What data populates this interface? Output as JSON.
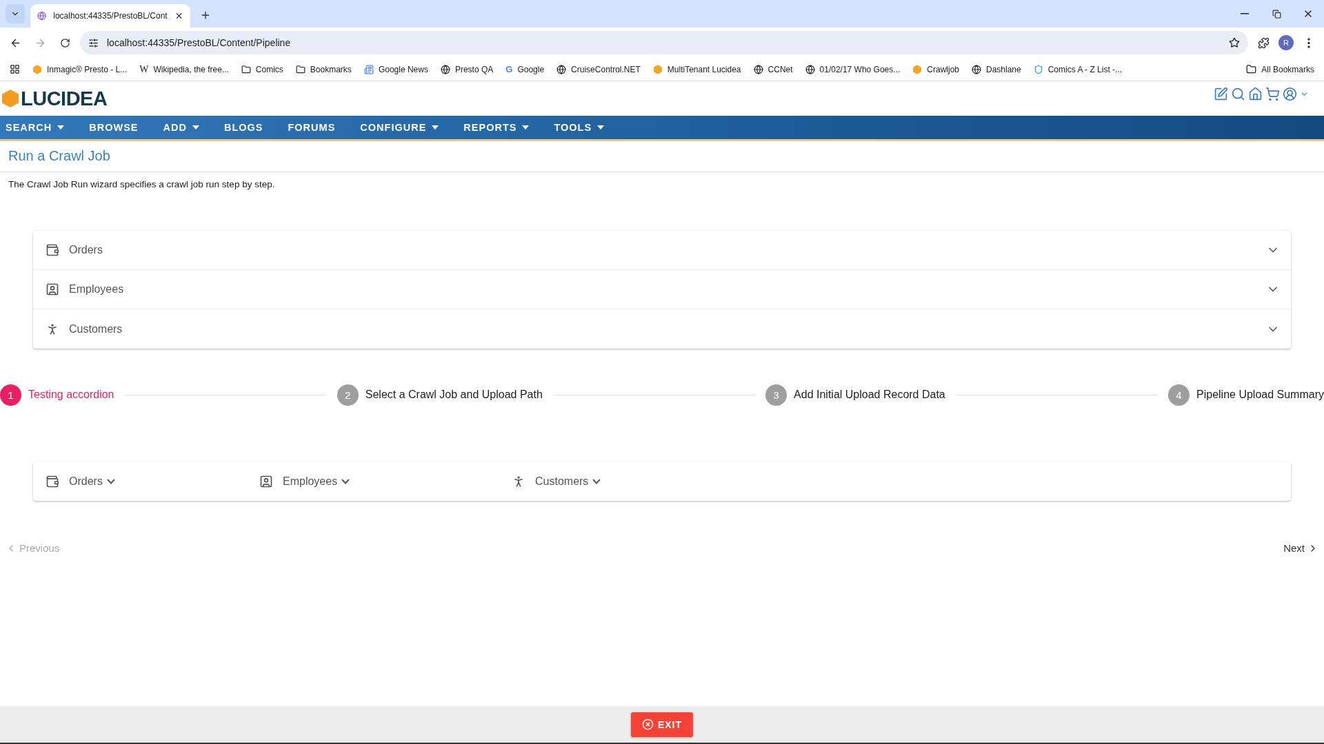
{
  "browser": {
    "tab_title": "localhost:44335/PrestoBL/Cont",
    "url": "localhost:44335/PrestoBL/Content/Pipeline",
    "profile": "R",
    "bookmarks": [
      {
        "kind": "cube",
        "label": "Inmagic® Presto - L..."
      },
      {
        "kind": "wiki",
        "glyph": "W",
        "label": "Wikipedia, the free..."
      },
      {
        "kind": "folder",
        "label": "Comics"
      },
      {
        "kind": "folder",
        "label": "Bookmarks"
      },
      {
        "kind": "news",
        "label": "Google News"
      },
      {
        "kind": "globe",
        "label": "Presto QA"
      },
      {
        "kind": "google",
        "glyph": "G",
        "label": "Google"
      },
      {
        "kind": "globe",
        "label": "CruiseControl.NET"
      },
      {
        "kind": "cube",
        "label": "MultiTenant Lucidea"
      },
      {
        "kind": "globe",
        "label": "CCNet"
      },
      {
        "kind": "globe",
        "label": "01/02/17 Who Goes..."
      },
      {
        "kind": "cube",
        "label": "Crawljob"
      },
      {
        "kind": "globe",
        "label": "Dashlane"
      },
      {
        "kind": "shield",
        "label": "Comics A - Z List -..."
      }
    ],
    "all_bookmarks": "All Bookmarks"
  },
  "logo": "LUCIDEA",
  "nav": [
    {
      "label": "SEARCH",
      "dropdown": true
    },
    {
      "label": "BROWSE",
      "dropdown": false
    },
    {
      "label": "ADD",
      "dropdown": true
    },
    {
      "label": "BLOGS",
      "dropdown": false
    },
    {
      "label": "FORUMS",
      "dropdown": false
    },
    {
      "label": "CONFIGURE",
      "dropdown": true
    },
    {
      "label": "REPORTS",
      "dropdown": true
    },
    {
      "label": "TOOLS",
      "dropdown": true
    }
  ],
  "page_title": "Run a Crawl Job",
  "description": "The Crawl Job Run wizard specifies a crawl job run step by step.",
  "accordion": [
    {
      "kind": "wallet",
      "label": "Orders"
    },
    {
      "kind": "contact",
      "label": "Employees"
    },
    {
      "kind": "person",
      "label": "Customers"
    }
  ],
  "steps": [
    {
      "number": "1",
      "label": "Testing accordion",
      "selected": true
    },
    {
      "number": "2",
      "label": "Select a Crawl Job and Upload Path",
      "selected": false
    },
    {
      "number": "3",
      "label": "Add Initial Upload Record Data",
      "selected": false
    },
    {
      "number": "4",
      "label": "Pipeline Upload Summary",
      "selected": false
    }
  ],
  "menu_bar": [
    {
      "kind": "wallet",
      "label": "Orders"
    },
    {
      "kind": "contact",
      "label": "Employees"
    },
    {
      "kind": "person",
      "label": "Customers"
    }
  ],
  "previous": {
    "label": "Previous",
    "disabled": true
  },
  "next": {
    "label": "Next",
    "disabled": false
  },
  "exit": "EXIT"
}
